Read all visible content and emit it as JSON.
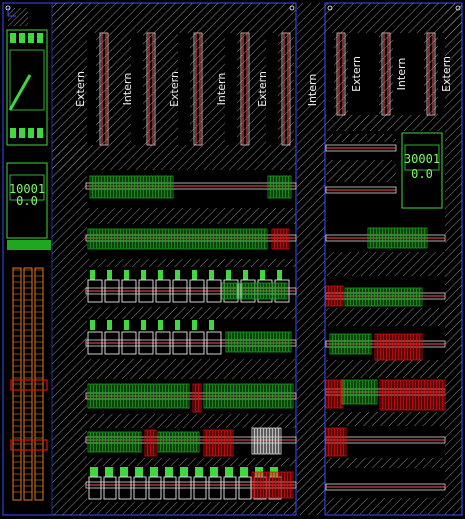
{
  "colors": {
    "background": "#000000",
    "frame": "#3a52ff",
    "hatch": "#8a8a8a",
    "rail": "#d8d8d8",
    "rail_red": "#ff5050",
    "terminal_green": "#1fa81f",
    "terminal_red": "#e01010",
    "terminal_white": "#e8e8e8",
    "terminal_orange": "#e07820",
    "component_green": "#3fd83f"
  },
  "drawing": {
    "left_cabinet": {
      "vertical_ducts": [
        "Extern",
        "Intern",
        "Extern",
        "Intern",
        "Extern"
      ],
      "relay": {
        "number": "10001",
        "sub": "0.0"
      }
    },
    "middle_duct": {
      "label": "Intern"
    },
    "right_cabinet": {
      "vertical_ducts": [
        "Extern",
        "Intern",
        "Extern"
      ],
      "relay": {
        "number": "30001",
        "sub": "0.0"
      }
    }
  }
}
